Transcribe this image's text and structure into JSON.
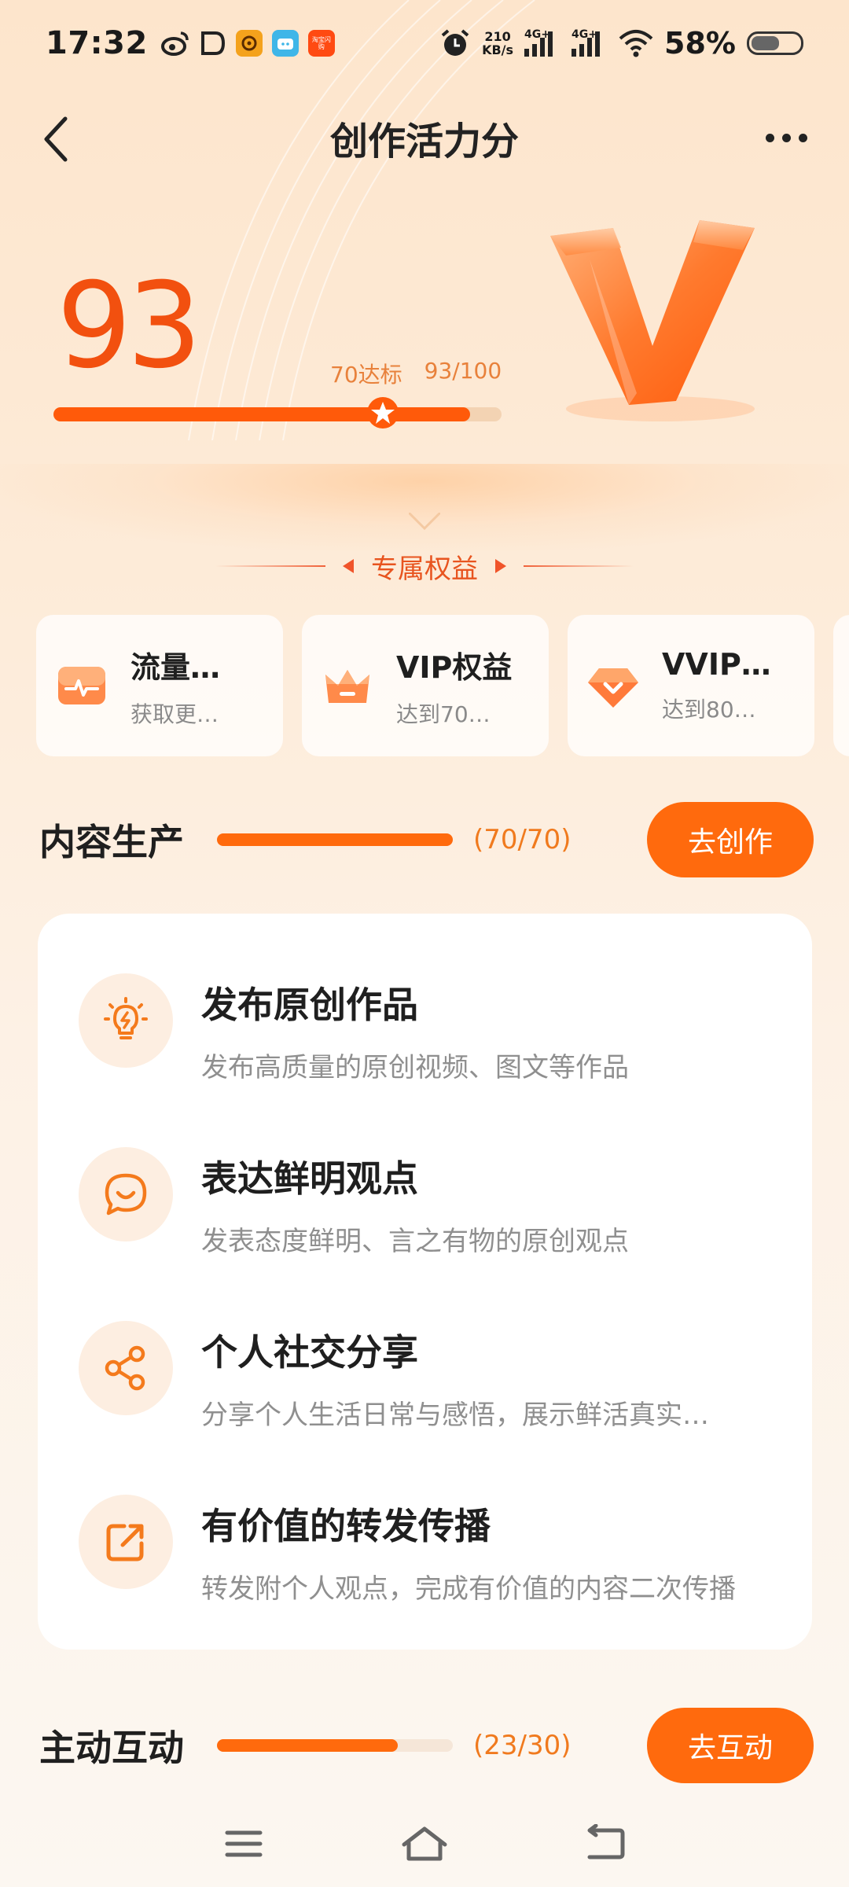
{
  "status_bar": {
    "time": "17:32",
    "net_speed_value": "210",
    "net_speed_unit": "KB/s",
    "signal_1": "4G+",
    "signal_2": "4G+",
    "battery_percent": "58%",
    "battery_level": 0.58,
    "app_badge": "淘宝闪购"
  },
  "header": {
    "title": "创作活力分"
  },
  "score": {
    "value": "93",
    "threshold_label": "70达标",
    "progress_label": "93/100",
    "progress": 0.93,
    "threshold": 0.7
  },
  "benefits": {
    "title": "专属权益",
    "items": [
      {
        "title": "流量…",
        "subtitle": "获取更…",
        "icon": "traffic-icon"
      },
      {
        "title": "VIP权益",
        "subtitle": "达到70…",
        "icon": "crown-icon"
      },
      {
        "title": "VVIP…",
        "subtitle": "达到80…",
        "icon": "diamond-icon"
      }
    ]
  },
  "content_section": {
    "title": "内容生产",
    "count": "(70/70)",
    "progress": 1.0,
    "button": "去创作",
    "tasks": [
      {
        "title": "发布原创作品",
        "desc": "发布高质量的原创视频、图文等作品",
        "icon": "lightbulb-icon"
      },
      {
        "title": "表达鲜明观点",
        "desc": "发表态度鲜明、言之有物的原创观点",
        "icon": "speech-bubble-icon"
      },
      {
        "title": "个人社交分享",
        "desc": "分享个人生活日常与感悟，展示鲜活真实…",
        "icon": "share-icon"
      },
      {
        "title": "有价值的转发传播",
        "desc": "转发附个人观点，完成有价值的内容二次传播",
        "icon": "forward-icon"
      }
    ]
  },
  "interaction_section": {
    "title": "主动互动",
    "count": "(23/30)",
    "progress": 0.7667,
    "button": "去互动"
  },
  "colors": {
    "accent": "#ff6a0d",
    "score": "#f2500f",
    "background_top": "#fde5cc"
  }
}
